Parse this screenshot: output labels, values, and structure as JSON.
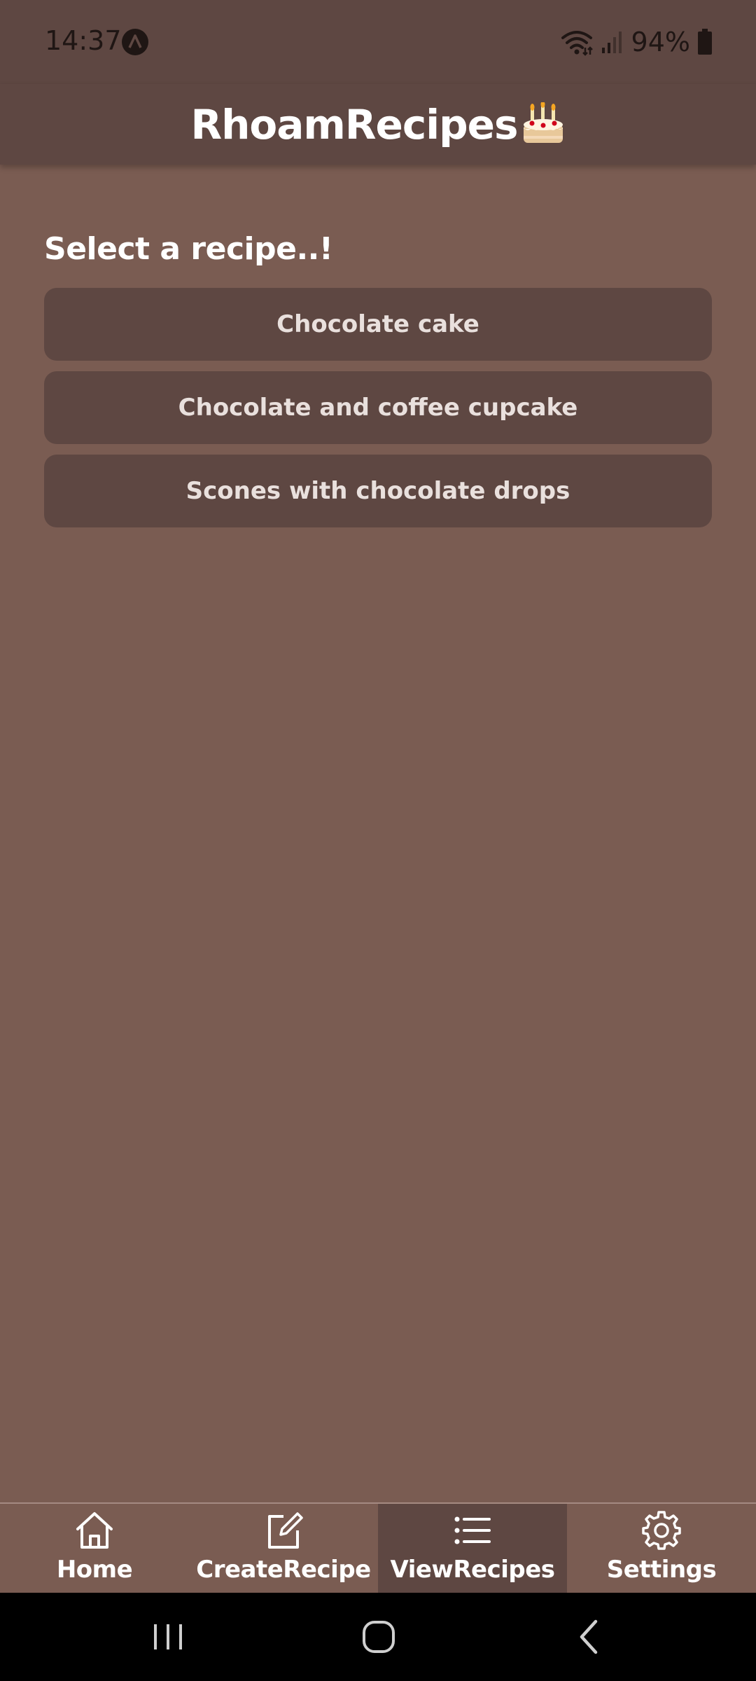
{
  "status_bar": {
    "time": "14:37",
    "battery": "94%",
    "icons": [
      "app-notification-icon",
      "wifi-icon",
      "signal-icon",
      "battery-icon"
    ]
  },
  "header": {
    "title": "RhoamRecipes",
    "icon": "cake-icon"
  },
  "main": {
    "section_title": "Select a recipe..!",
    "recipes": [
      {
        "label": "Chocolate cake"
      },
      {
        "label": "Chocolate and coffee cupcake"
      },
      {
        "label": "Scones with chocolate drops"
      }
    ]
  },
  "bottom_nav": {
    "active": "ViewRecipes",
    "items": [
      {
        "label": "Home",
        "icon": "home-icon"
      },
      {
        "label": "CreateRecipe",
        "icon": "edit-icon"
      },
      {
        "label": "ViewRecipes",
        "icon": "list-icon"
      },
      {
        "label": "Settings",
        "icon": "gear-icon"
      }
    ]
  },
  "system_nav": {
    "buttons": [
      "recents-icon",
      "home-circle-icon",
      "back-icon"
    ]
  },
  "colors": {
    "background": "#7a5c52",
    "header": "#5e4742",
    "button": "#5e4742",
    "text": "#ffffff",
    "button_text": "#e9e0dd"
  }
}
